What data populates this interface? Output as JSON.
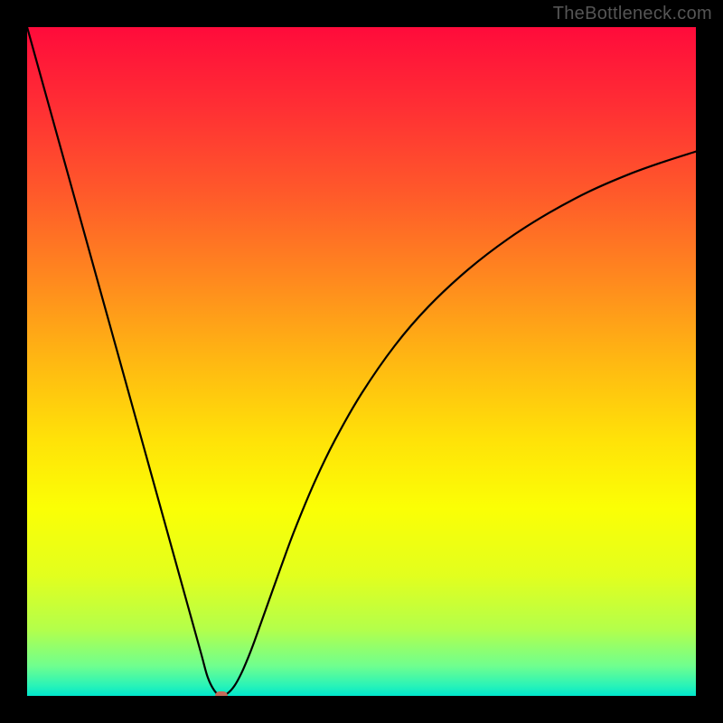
{
  "watermark": "TheBottleneck.com",
  "chart_data": {
    "type": "line",
    "title": "",
    "xlabel": "",
    "ylabel": "",
    "xlim": [
      0,
      100
    ],
    "ylim": [
      0,
      100
    ],
    "background_gradient_stops": [
      {
        "offset": 0.0,
        "color": "#ff0b3b"
      },
      {
        "offset": 0.12,
        "color": "#ff2f34"
      },
      {
        "offset": 0.25,
        "color": "#ff5a2a"
      },
      {
        "offset": 0.38,
        "color": "#ff8a1e"
      },
      {
        "offset": 0.5,
        "color": "#ffb812"
      },
      {
        "offset": 0.62,
        "color": "#ffe308"
      },
      {
        "offset": 0.72,
        "color": "#fbff05"
      },
      {
        "offset": 0.82,
        "color": "#e2ff1e"
      },
      {
        "offset": 0.9,
        "color": "#b4ff4a"
      },
      {
        "offset": 0.955,
        "color": "#70ff8e"
      },
      {
        "offset": 0.985,
        "color": "#28f3b8"
      },
      {
        "offset": 1.0,
        "color": "#00e6cc"
      }
    ],
    "series": [
      {
        "name": "bottleneck-curve",
        "x": [
          0,
          2,
          4,
          6,
          8,
          10,
          12,
          14,
          16,
          18,
          20,
          22,
          24,
          26,
          27,
          28,
          29,
          30,
          31,
          32,
          33,
          34,
          36,
          38,
          40,
          43,
          46,
          50,
          55,
          60,
          66,
          72,
          78,
          84,
          90,
          95,
          100
        ],
        "y": [
          100,
          92.8,
          85.6,
          78.4,
          71.2,
          64.0,
          56.8,
          49.6,
          42.4,
          35.2,
          28.0,
          20.8,
          13.6,
          6.4,
          2.8,
          0.8,
          0.0,
          0.4,
          1.5,
          3.3,
          5.6,
          8.2,
          13.8,
          19.4,
          24.8,
          32.0,
          38.2,
          45.2,
          52.4,
          58.2,
          63.8,
          68.4,
          72.2,
          75.4,
          78.0,
          79.8,
          81.4
        ]
      }
    ],
    "marker": {
      "x": 29,
      "y": 0
    }
  }
}
